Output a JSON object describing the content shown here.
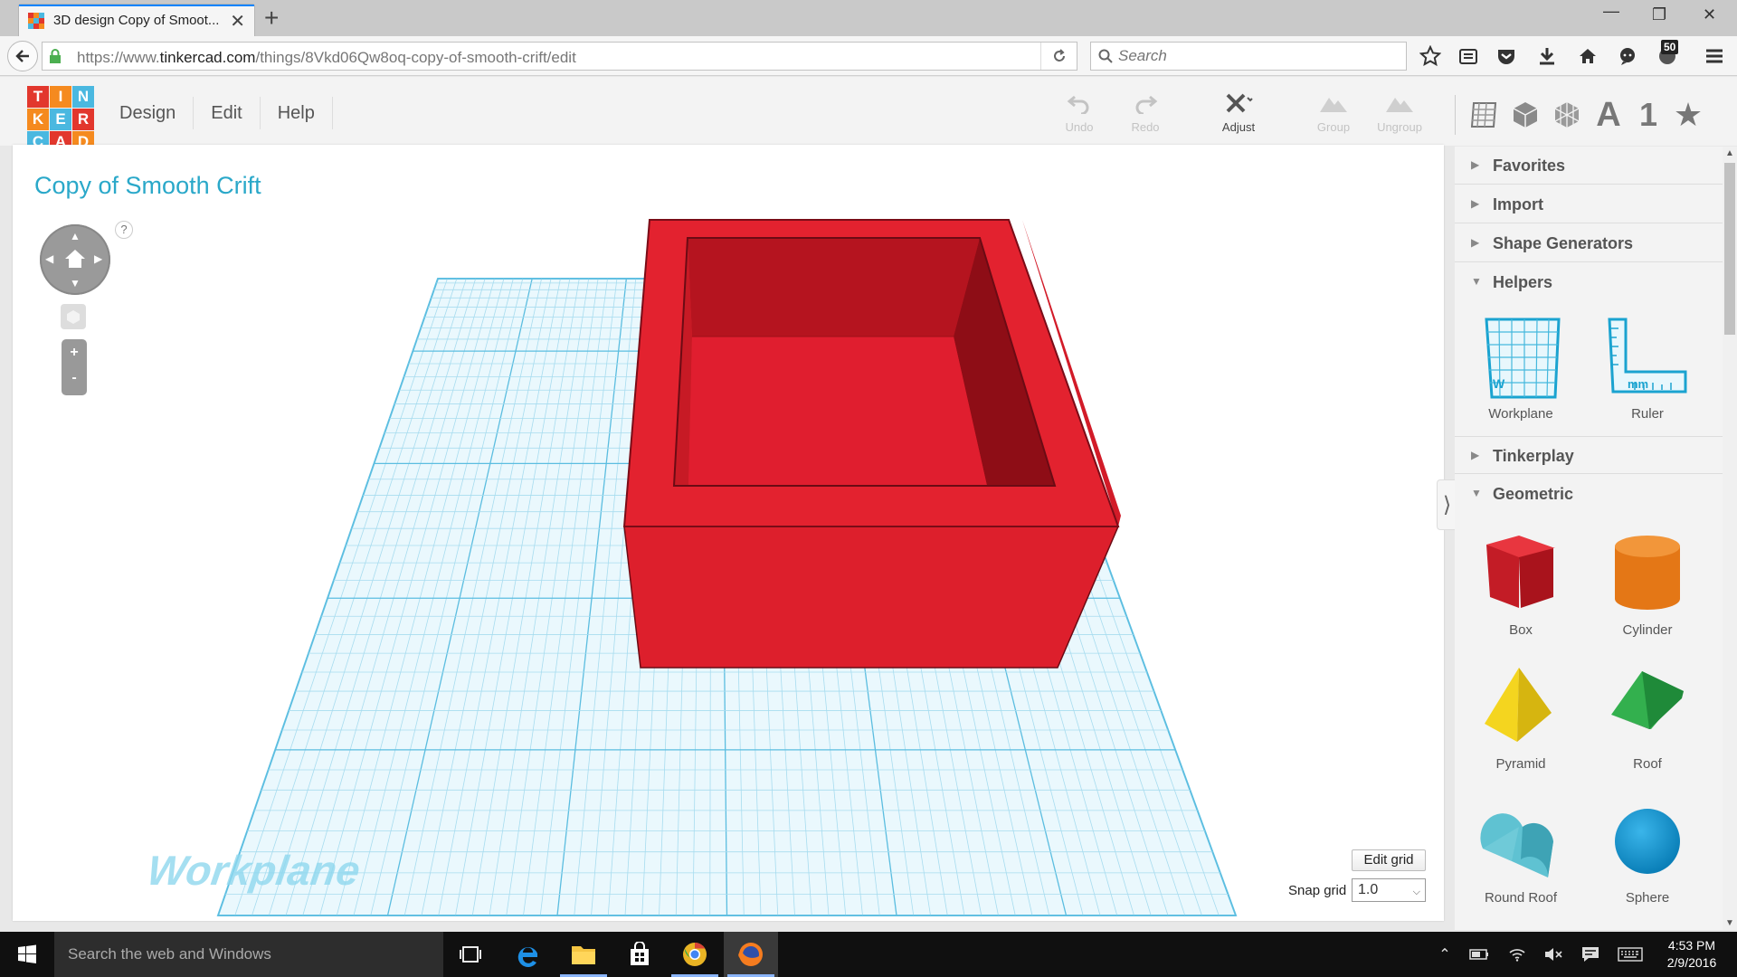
{
  "browser": {
    "tab_title": "3D design Copy of Smoot...",
    "url_prefix": "https://www.",
    "url_domain": "tinkercad.com",
    "url_path": "/things/8Vkd06Qw8oq-copy-of-smooth-crift/edit",
    "search_placeholder": "Search",
    "notification_count": "50"
  },
  "app": {
    "logo_letters": [
      "T",
      "I",
      "N",
      "K",
      "E",
      "R",
      "C",
      "A",
      "D"
    ],
    "logo_colors": [
      "#e2372d",
      "#f58a1f",
      "#4ab8e0",
      "#f58a1f",
      "#4ab8e0",
      "#e2372d",
      "#4ab8e0",
      "#e2372d",
      "#f58a1f"
    ],
    "menu": [
      "Design",
      "Edit",
      "Help"
    ],
    "toolbar": {
      "undo": "Undo",
      "redo": "Redo",
      "adjust": "Adjust",
      "group": "Group",
      "ungroup": "Ungroup"
    },
    "view_icons": [
      "workplane-view-icon",
      "box-view-icon",
      "wireframe-view-icon",
      "text-a-icon",
      "number-one-icon",
      "star-icon"
    ],
    "view_glyphs": {
      "text": "A",
      "number": "1",
      "star": "★"
    }
  },
  "workspace": {
    "design_title": "Copy of Smooth Crift",
    "help": "?",
    "workplane_label": "Workplane",
    "edit_grid": "Edit grid",
    "snap_grid_label": "Snap grid",
    "snap_grid_value": "1.0",
    "zoom_in": "+",
    "zoom_out": "-"
  },
  "panel": {
    "sections": {
      "favorites": "Favorites",
      "import": "Import",
      "shape_generators": "Shape Generators",
      "helpers": "Helpers",
      "tinkerplay": "Tinkerplay",
      "geometric": "Geometric"
    },
    "helpers": [
      "Workplane",
      "Ruler"
    ],
    "helper_marks": {
      "workplane": "W",
      "ruler": "mm"
    },
    "shapes": [
      "Box",
      "Cylinder",
      "Pyramid",
      "Roof",
      "Round Roof",
      "Sphere"
    ],
    "shape_colors": {
      "box": "#d3232b",
      "cylinder": "#e8771a",
      "pyramid": "#f2d21b",
      "roof": "#2fa94a",
      "round_roof": "#5fc2d2",
      "sphere": "#1a9bd6"
    }
  },
  "taskbar": {
    "search": "Search the web and Windows",
    "time": "4:53 PM",
    "date": "2/9/2016"
  },
  "colors": {
    "accent": "#2aa8c9",
    "grid": "#7fd3ea",
    "box_red": "#e01e2f"
  }
}
